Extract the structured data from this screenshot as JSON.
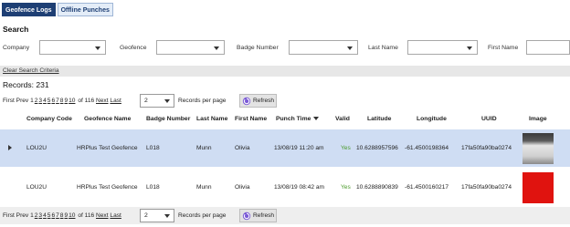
{
  "tabs": [
    {
      "label": "Geofence Logs",
      "active": true
    },
    {
      "label": "Offline Punches",
      "active": false
    }
  ],
  "search": {
    "title": "Search",
    "filters": {
      "company_label": "Company",
      "geofence_label": "Geofence",
      "badge_label": "Badge Number",
      "lastname_label": "Last Name",
      "firstname_label": "First Name"
    },
    "clear_label": "Clear Search Criteria"
  },
  "records": {
    "text": "Records:  231"
  },
  "pager": {
    "first": "First",
    "prev": "Prev",
    "pages": [
      "1",
      "2",
      "3",
      "4",
      "5",
      "6",
      "7",
      "8",
      "9",
      "10"
    ],
    "of_text": "of 116",
    "next": "Next",
    "last": "Last",
    "page_size": "2",
    "per_page_label": "Records per page",
    "refresh_label": "Refresh"
  },
  "table": {
    "headers": {
      "company_code": "Company Code",
      "geofence_name": "Geofence Name",
      "badge_number": "Badge Number",
      "last_name": "Last Name",
      "first_name": "First Name",
      "punch_time": "Punch Time",
      "valid": "Valid",
      "latitude": "Latitude",
      "longitude": "Longitude",
      "uuid": "UUID",
      "image": "Image"
    },
    "rows": [
      {
        "company_code": "LOU2U",
        "geofence_name": "HRPlus Test Geofence",
        "badge_number": "L018",
        "last_name": "Munn",
        "first_name": "Olivia",
        "punch_time": "13/08/19 11:20 am",
        "valid": "Yes",
        "latitude": "10.6288957596",
        "longitude": "-61.4500198364",
        "uuid": "17fa50fa90ba0274"
      },
      {
        "company_code": "LOU2U",
        "geofence_name": "HRPlus Test Geofence",
        "badge_number": "L018",
        "last_name": "Munn",
        "first_name": "Olivia",
        "punch_time": "13/08/19 08:42 am",
        "valid": "Yes",
        "latitude": "10.6288890839",
        "longitude": "-61.4500160217",
        "uuid": "17fa50fa90ba0274"
      }
    ]
  },
  "colors": {
    "tab_active": "#1e3f74",
    "selected_row": "#cfddf3",
    "valid_text": "#4a9a2a"
  }
}
